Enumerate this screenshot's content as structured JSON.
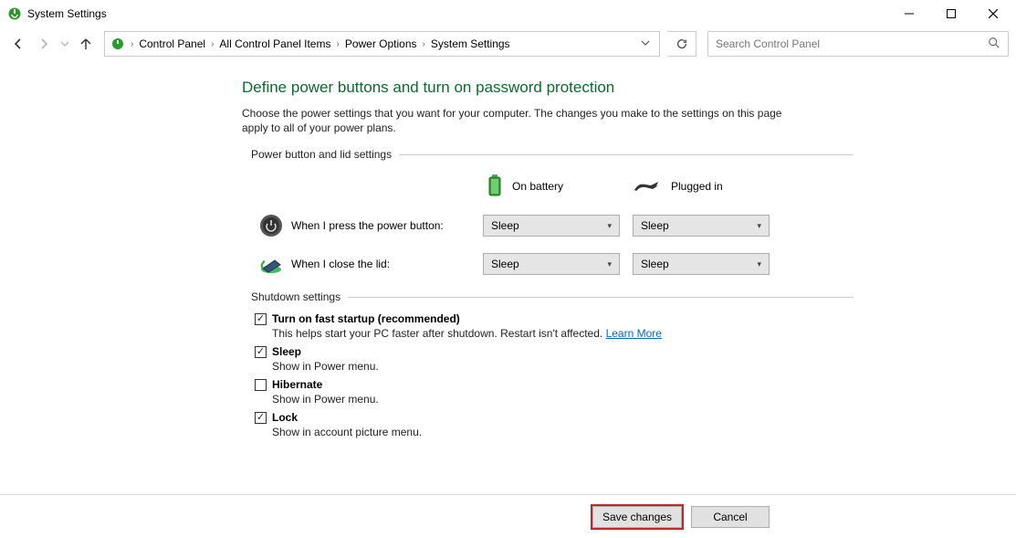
{
  "window": {
    "title": "System Settings",
    "minimize": "—",
    "maximize": "▢",
    "close": "✕"
  },
  "breadcrumbs": {
    "items": [
      "Control Panel",
      "All Control Panel Items",
      "Power Options",
      "System Settings"
    ]
  },
  "search": {
    "placeholder": "Search Control Panel"
  },
  "page": {
    "heading": "Define power buttons and turn on password protection",
    "description": "Choose the power settings that you want for your computer. The changes you make to the settings on this page apply to all of your power plans.",
    "section_power": "Power button and lid settings",
    "col_battery": "On battery",
    "col_plugged": "Plugged in",
    "power_button_label": "When I press the power button:",
    "lid_label": "When I close the lid:",
    "power_button_battery": "Sleep",
    "power_button_plugged": "Sleep",
    "lid_battery": "Sleep",
    "lid_plugged": "Sleep",
    "section_shutdown": "Shutdown settings",
    "fast_startup": {
      "label": "Turn on fast startup (recommended)",
      "sub": "This helps start your PC faster after shutdown. Restart isn't affected. ",
      "link": "Learn More",
      "checked": true
    },
    "sleep": {
      "label": "Sleep",
      "sub": "Show in Power menu.",
      "checked": true
    },
    "hibernate": {
      "label": "Hibernate",
      "sub": "Show in Power menu.",
      "checked": false
    },
    "lock": {
      "label": "Lock",
      "sub": "Show in account picture menu.",
      "checked": true
    }
  },
  "footer": {
    "save": "Save changes",
    "cancel": "Cancel"
  }
}
